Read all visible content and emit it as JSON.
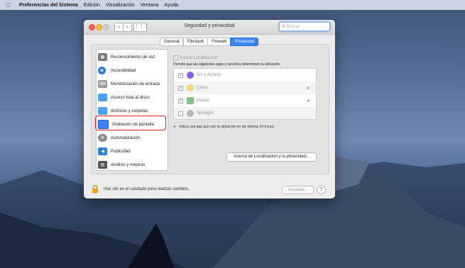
{
  "menubar": {
    "app_name": "Preferencias del Sistema",
    "items": [
      "Edición",
      "Visualización",
      "Ventana",
      "Ayuda"
    ]
  },
  "window": {
    "title": "Seguridad y privacidad",
    "search_placeholder": "Buscar"
  },
  "tabs": [
    {
      "label": "General",
      "active": false
    },
    {
      "label": "FileVault",
      "active": false
    },
    {
      "label": "Firewall",
      "active": false
    },
    {
      "label": "Privacidad",
      "active": true
    }
  ],
  "sidebar": {
    "items": [
      {
        "label": "Reconocimiento de voz",
        "icon": "waveform-icon",
        "color": "#7a7a7a"
      },
      {
        "label": "Accesibilidad",
        "icon": "accessibility-icon",
        "color": "#2c7be5"
      },
      {
        "label": "Monitorización de entrada",
        "icon": "keyboard-icon",
        "color": "#9a9a9a"
      },
      {
        "label": "Acceso total al disco",
        "icon": "folder-icon",
        "color": "#4aa3f0"
      },
      {
        "label": "Archivos y carpetas",
        "icon": "folder-icon",
        "color": "#4aa3f0"
      },
      {
        "label": "Grabación de pantalla",
        "icon": "display-icon",
        "color": "#3b82f6"
      },
      {
        "label": "Automatización",
        "icon": "gear-icon",
        "color": "#8a8a8a"
      },
      {
        "label": "Publicidad",
        "icon": "megaphone-icon",
        "color": "#2f7fd6"
      },
      {
        "label": "Análisis y mejoras",
        "icon": "chart-icon",
        "color": "#555555"
      }
    ],
    "highlighted": "Grabación de pantalla"
  },
  "privacy": {
    "enable_location_label": "Activar Localización",
    "description": "Permite que las siguientes apps y servicios determinen tu ubicación.",
    "apps": [
      {
        "name": "Siri y dictado",
        "checked": true,
        "icon_color": "#8b5cf6",
        "arrow": false
      },
      {
        "name": "Clima",
        "checked": true,
        "icon_color": "#f5d76e",
        "arrow": true
      },
      {
        "name": "Mapas",
        "checked": true,
        "icon_color": "#7cc47f",
        "arrow": true
      },
      {
        "name": "Spotlight",
        "checked": false,
        "icon_color": "#b9b9b9",
        "arrow": false
      }
    ],
    "hint": "Indica una app que usó tu ubicación en las últimas 24 horas.",
    "about_button": "Acerca de Localización y la privacidad..."
  },
  "footer": {
    "lock_text": "Haz clic en el candado para realizar cambios.",
    "advanced_button": "Avanzado...",
    "help_button": "?"
  }
}
